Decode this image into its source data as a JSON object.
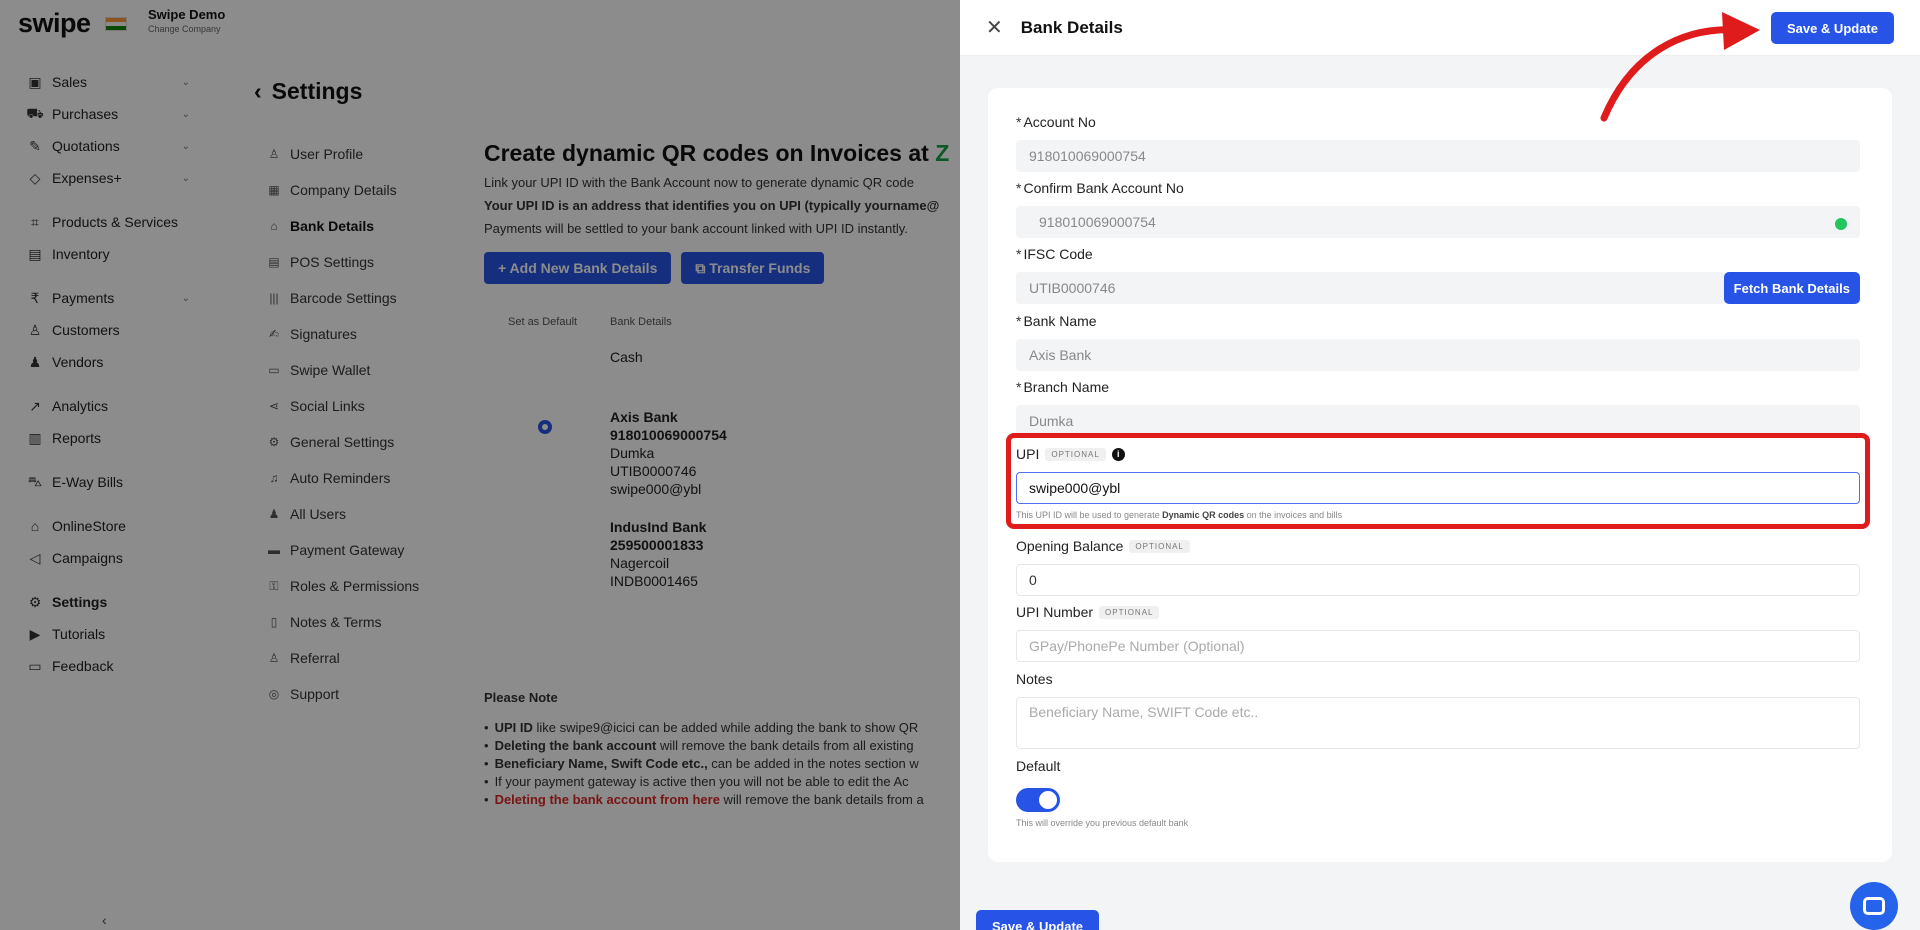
{
  "app": {
    "logo": "swipe",
    "company_name": "Swipe Demo",
    "company_sub": "Change Company"
  },
  "nav": [
    {
      "label": "Sales",
      "icon": "sales-icon",
      "chev": "⌄"
    },
    {
      "label": "Purchases",
      "icon": "cart-icon",
      "chev": "⌄"
    },
    {
      "label": "Quotations",
      "icon": "pen-icon",
      "chev": "⌄"
    },
    {
      "label": "Expenses+",
      "icon": "tag-icon",
      "chev": "⌄"
    },
    {
      "label": "Products & Services",
      "icon": "products-icon"
    },
    {
      "label": "Inventory",
      "icon": "inventory-icon"
    },
    {
      "label": "Payments",
      "icon": "rupee-icon",
      "chev": "⌄"
    },
    {
      "label": "Customers",
      "icon": "user-icon"
    },
    {
      "label": "Vendors",
      "icon": "vendors-icon"
    },
    {
      "label": "Analytics",
      "icon": "analytics-icon"
    },
    {
      "label": "Reports",
      "icon": "reports-icon"
    },
    {
      "label": "E-Way Bills",
      "icon": "truck-icon"
    },
    {
      "label": "OnlineStore",
      "icon": "store-icon"
    },
    {
      "label": "Campaigns",
      "icon": "megaphone-icon"
    },
    {
      "label": "Settings",
      "icon": "gear-icon"
    },
    {
      "label": "Tutorials",
      "icon": "youtube-icon"
    },
    {
      "label": "Feedback",
      "icon": "feedback-icon"
    }
  ],
  "settings": {
    "title": "Settings",
    "subnav": [
      "User Profile",
      "Company Details",
      "Bank Details",
      "POS Settings",
      "Barcode Settings",
      "Signatures",
      "Swipe Wallet",
      "Social Links",
      "General Settings",
      "Auto Reminders",
      "All Users",
      "Payment Gateway",
      "Roles & Permissions",
      "Notes & Terms",
      "Referral",
      "Support"
    ]
  },
  "main": {
    "heading": "Create dynamic QR codes on Invoices at ",
    "heading_hl": "Z",
    "line1": "Link your UPI ID with the Bank Account now to generate dynamic QR code",
    "line2": "Your UPI ID is an address that identifies you on UPI (typically yourname@",
    "line3": "Payments will be settled to your bank account linked with UPI ID instantly.",
    "add_btn": "+ Add New Bank Details",
    "transfer_btn": "Transfer Funds",
    "col_default": "Set as Default",
    "col_bank": "Bank Details",
    "cash": "Cash",
    "bank1": {
      "name": "Axis Bank",
      "acc": "918010069000754",
      "branch": "Dumka",
      "ifsc": "UTIB0000746",
      "upi": "swipe000@ybl"
    },
    "bank2": {
      "name": "IndusInd Bank",
      "acc": "259500001833",
      "branch": "Nagercoil",
      "ifsc": "INDB0001465"
    }
  },
  "note": {
    "title": "Please Note",
    "items": [
      {
        "b": "UPI ID",
        "t": " like swipe9@icici can be added while adding the bank to show QR"
      },
      {
        "b": "Deleting the bank account",
        "t": " will remove the bank details from all existing"
      },
      {
        "b": "Beneficiary Name, Swift Code etc.,",
        "t": " can be added in the notes section w"
      },
      {
        "b": "",
        "t": "If your payment gateway is active then you will not be able to edit the Ac"
      },
      {
        "red": "Deleting the bank account from here",
        "t": " will remove the bank details from a"
      }
    ]
  },
  "drawer": {
    "title": "Bank Details",
    "save_label": "Save & Update",
    "fields": {
      "account_no": {
        "label": "Account No",
        "value": "918010069000754"
      },
      "confirm_no": {
        "label": "Confirm Bank Account No",
        "value": "918010069000754"
      },
      "ifsc": {
        "label": "IFSC Code",
        "value": "UTIB0000746",
        "fetch": "Fetch Bank Details"
      },
      "bank_name": {
        "label": "Bank Name",
        "value": "Axis Bank"
      },
      "branch": {
        "label": "Branch Name",
        "value": "Dumka"
      },
      "upi": {
        "label": "UPI",
        "badge": "OPTIONAL",
        "value": "swipe000@ybl",
        "helper_pre": "This UPI ID will be used to generate ",
        "helper_b": "Dynamic QR codes",
        "helper_post": " on the invoices and bills"
      },
      "opening": {
        "label": "Opening Balance",
        "badge": "OPTIONAL",
        "value": "0"
      },
      "upi_number": {
        "label": "UPI Number",
        "badge": "OPTIONAL",
        "placeholder": "GPay/PhonePe Number (Optional)"
      },
      "notes": {
        "label": "Notes",
        "placeholder": "Beneficiary Name, SWIFT Code etc.."
      },
      "default": {
        "label": "Default",
        "helper": "This will override you previous default bank"
      }
    }
  },
  "colors": {
    "accent": "#2754e6",
    "highlight": "#e01b1b",
    "success": "#22c55e"
  }
}
